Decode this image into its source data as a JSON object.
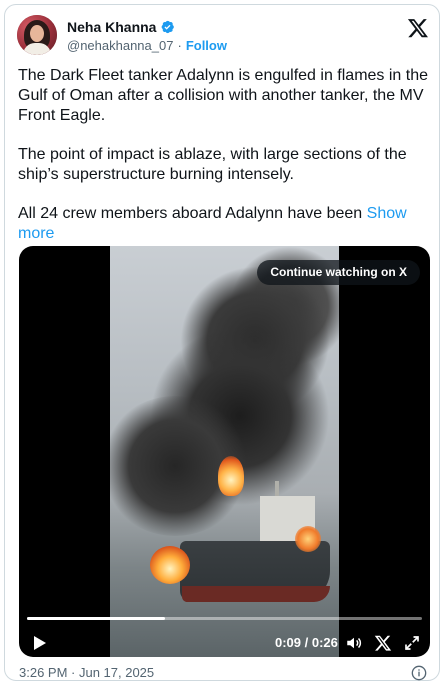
{
  "author": {
    "display_name": "Neha Khanna",
    "handle": "@nehakhanna_07",
    "separator": "·",
    "follow_label": "Follow",
    "verified": true
  },
  "tweet": {
    "paragraphs": [
      "The Dark Fleet tanker Adalynn is engulfed in flames in the Gulf of Oman after a collision with another tanker, the MV Front Eagle.",
      "The point of impact is ablaze, with large sections of the ship’s superstructure burning intensely."
    ],
    "truncated_text": "All 24 crew members aboard Adalynn have been ",
    "show_more_label": "Show more"
  },
  "media": {
    "continue_label": "Continue watching on X",
    "time_display": "0:09 / 0:26",
    "progress_fraction": 0.35
  },
  "footer": {
    "timestamp": "3:26 PM · Jun 17, 2025"
  },
  "colors": {
    "accent": "#1d9bf0",
    "text": "#0f1419",
    "muted": "#536471"
  },
  "icons": {
    "verified": "verified-badge-icon",
    "logo": "x-logo-icon",
    "play": "play-icon",
    "volume": "volume-icon",
    "expand": "expand-icon",
    "info": "info-icon"
  }
}
